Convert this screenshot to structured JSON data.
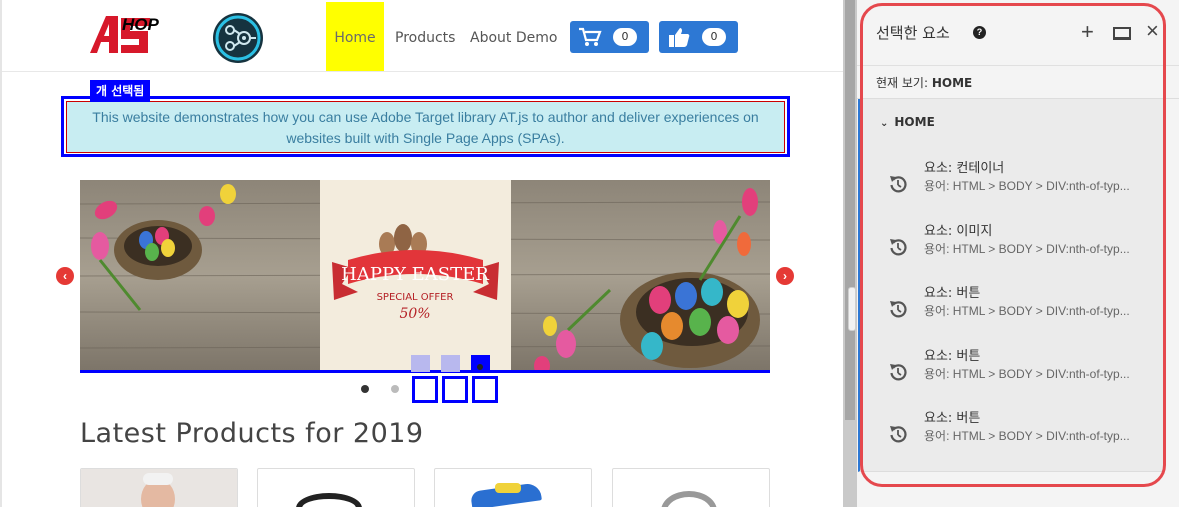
{
  "site": {
    "logo_text": "HOP",
    "nav": {
      "home": "Home",
      "products": "Products",
      "about": "About Demo"
    },
    "cart_count": "0",
    "like_count": "0",
    "selection_tag": "개 선택됨",
    "alert_text": "This website demonstrates how you can use Adobe Target library AT.js to author and deliver experiences on websites built with Single Page Apps (SPAs).",
    "banner": {
      "title": "HAPPY EASTER",
      "subtitle": "SPECIAL OFFER",
      "discount": "50%"
    },
    "products_heading": "Latest Products for 2019"
  },
  "panel": {
    "title": "선택한 요소",
    "current_view_label": "현재 보기:",
    "current_view_value": "HOME",
    "group_name": "HOME",
    "items": [
      {
        "title": "요소: 컨테이너",
        "path": "용어: HTML > BODY > DIV:nth-of-typ..."
      },
      {
        "title": "요소: 이미지",
        "path": "용어: HTML > BODY > DIV:nth-of-typ..."
      },
      {
        "title": "요소: 버튼",
        "path": "용어: HTML > BODY > DIV:nth-of-typ..."
      },
      {
        "title": "요소: 버튼",
        "path": "용어: HTML > BODY > DIV:nth-of-typ..."
      },
      {
        "title": "요소: 버튼",
        "path": "용어: HTML > BODY > DIV:nth-of-typ..."
      }
    ]
  },
  "colors": {
    "accent_blue": "#2d78d4",
    "selection_blue": "#0000ff",
    "highlight_yellow": "#ffff00",
    "outline_red": "#e5484d"
  }
}
